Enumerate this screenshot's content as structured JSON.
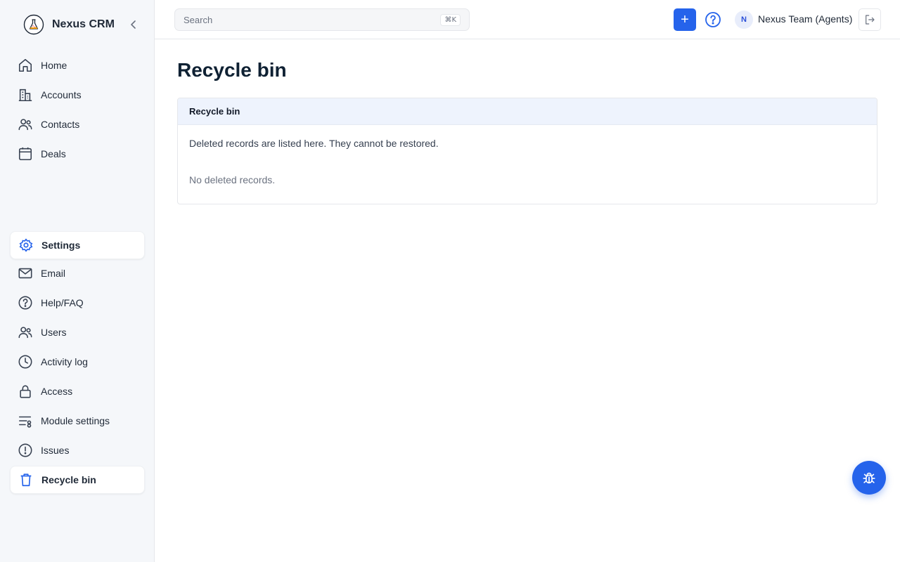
{
  "app": {
    "name": "Nexus CRM",
    "logo_icon": "flask-icon"
  },
  "sidebar": {
    "primary": [
      {
        "label": "Home",
        "icon": "home-icon"
      },
      {
        "label": "Accounts",
        "icon": "building-icon"
      },
      {
        "label": "Contacts",
        "icon": "users-icon"
      },
      {
        "label": "Deals",
        "icon": "calendar-icon"
      }
    ],
    "secondary": [
      {
        "label": "Settings",
        "icon": "settings-icon",
        "active": true
      },
      {
        "label": "Email",
        "icon": "mail-icon"
      },
      {
        "label": "Help/FAQ",
        "icon": "help-circle-icon"
      },
      {
        "label": "Users",
        "icon": "users-icon"
      },
      {
        "label": "Activity log",
        "icon": "clock-icon"
      },
      {
        "label": "Access",
        "icon": "lock-icon"
      },
      {
        "label": "Module settings",
        "icon": "sliders-icon"
      },
      {
        "label": "Issues",
        "icon": "alert-circle-icon"
      },
      {
        "label": "Recycle bin",
        "icon": "trash-icon",
        "active": true
      }
    ]
  },
  "header": {
    "search": {
      "placeholder": "Search",
      "shortcut": "⌘K"
    },
    "add_label": "+",
    "user": {
      "initial": "N",
      "name": "Nexus Team (Agents)"
    }
  },
  "main": {
    "title": "Recycle bin",
    "card": {
      "header": "Recycle bin",
      "description": "Deleted records are listed here. They cannot be restored.",
      "empty_text": "No deleted records."
    }
  },
  "colors": {
    "accent": "#2563eb",
    "sidebar_bg": "#f5f7fa",
    "card_header_bg": "#eef3fd"
  }
}
